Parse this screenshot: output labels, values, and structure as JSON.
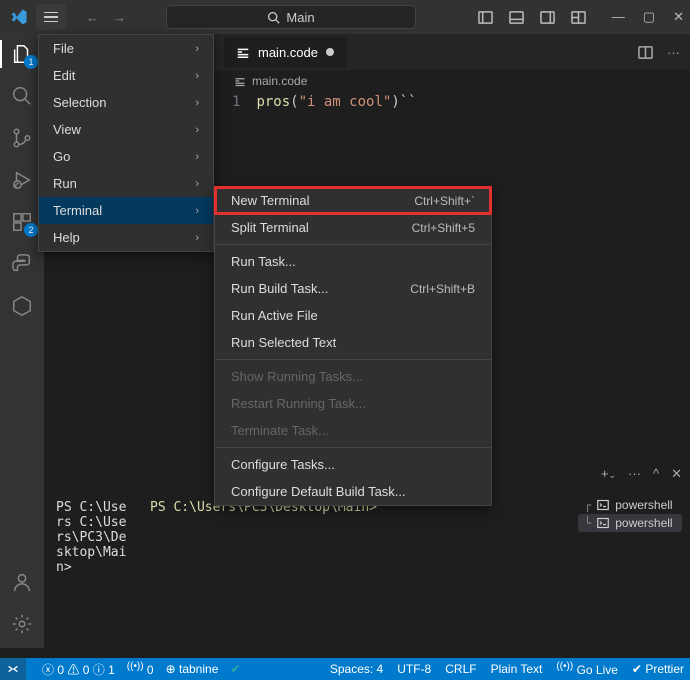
{
  "titlebar": {
    "search_label": "Main"
  },
  "activitybar": {
    "explorer_badge": "1",
    "ext_badge": "2"
  },
  "tab": {
    "label": "main.code"
  },
  "breadcrumb": {
    "file": "main.code"
  },
  "code": {
    "line_no": "1",
    "fn": "pros",
    "paren_open": "(",
    "str": "\"i am cool\"",
    "rest": ")``"
  },
  "main_menu": {
    "items": [
      {
        "label": "File"
      },
      {
        "label": "Edit"
      },
      {
        "label": "Selection"
      },
      {
        "label": "View"
      },
      {
        "label": "Go"
      },
      {
        "label": "Run"
      },
      {
        "label": "Terminal"
      },
      {
        "label": "Help"
      }
    ]
  },
  "submenu": {
    "items": [
      {
        "label": "New Terminal",
        "shortcut": "Ctrl+Shift+`",
        "highlighted": true
      },
      {
        "label": "Split Terminal",
        "shortcut": "Ctrl+Shift+5"
      },
      {
        "sep": true
      },
      {
        "label": "Run Task..."
      },
      {
        "label": "Run Build Task...",
        "shortcut": "Ctrl+Shift+B"
      },
      {
        "label": "Run Active File"
      },
      {
        "label": "Run Selected Text"
      },
      {
        "sep": true
      },
      {
        "label": "Show Running Tasks...",
        "disabled": true
      },
      {
        "label": "Restart Running Task...",
        "disabled": true
      },
      {
        "label": "Terminate Task...",
        "disabled": true
      },
      {
        "sep": true
      },
      {
        "label": "Configure Tasks..."
      },
      {
        "label": "Configure Default Build Task..."
      }
    ]
  },
  "terminal": {
    "col1": "PS C:\\Users C:\\Users\\PC3\\Desktop\\Main>",
    "col2": "PS C:\\Users\\PC3\\Desktop\\Main>",
    "partial": "Ma",
    "shells": [
      {
        "label": "powershell"
      },
      {
        "label": "powershell",
        "selected": true
      }
    ]
  },
  "statusbar": {
    "errors": "0",
    "warnings": "0",
    "info": "1",
    "port": "0",
    "tabnine": "tabnine",
    "spaces": "Spaces: 4",
    "encoding": "UTF-8",
    "eol": "CRLF",
    "lang": "Plain Text",
    "golive": "Go Live",
    "prettier": "Prettier"
  }
}
